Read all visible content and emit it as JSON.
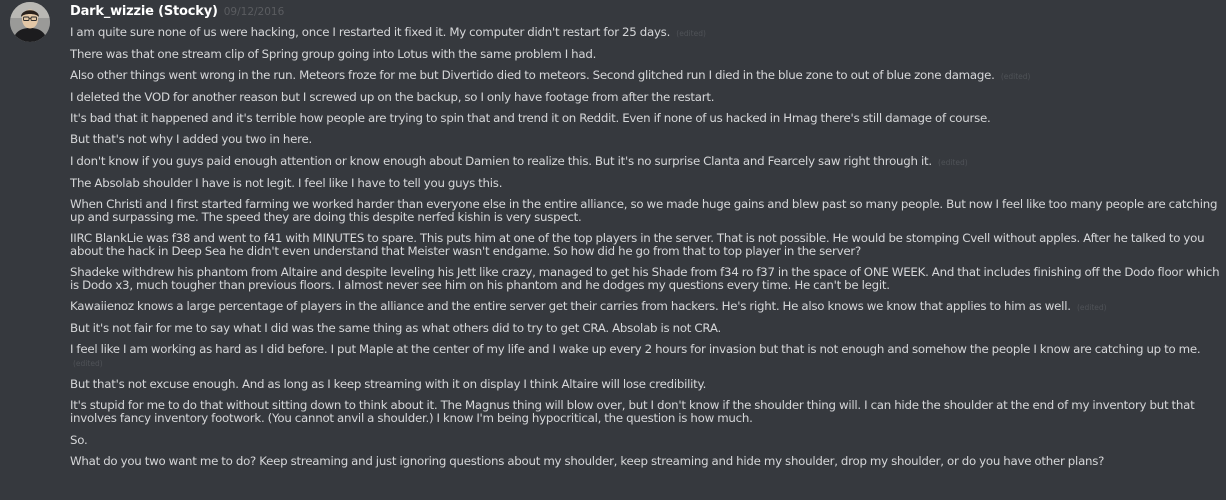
{
  "author": {
    "name": "Dark_wizzie (Stocky)",
    "timestamp": "09/12/2016"
  },
  "edited_label": "(edited)",
  "messages": [
    {
      "text": "I am quite sure none of us were hacking, once I restarted it fixed it. My  computer didn't restart for 25 days.",
      "edited": true
    },
    {
      "text": "There was that one stream clip of Spring group going into Lotus with the same problem I had.",
      "edited": false
    },
    {
      "text": "Also other things went wrong in the run. Meteors froze for me but Divertido died to meteors. Second glitched run I died in the blue zone to out of blue zone damage.",
      "edited": true
    },
    {
      "text": "I deleted the VOD for another reason but I screwed up on the backup, so I only have footage from after the restart.",
      "edited": false
    },
    {
      "text": "It's bad that it happened and it's terrible how people are trying to spin that and trend it on Reddit. Even if none of us hacked in Hmag there's still damage of course.",
      "edited": false
    },
    {
      "text": "But that's not why I added you two in here.",
      "edited": false
    },
    {
      "text": "I don't know if you guys paid enough attention or know enough about Damien to realize this. But it's no surprise Clanta and Fearcely saw right through it.",
      "edited": true
    },
    {
      "text": "The Absolab shoulder I have is not legit. I feel like I have to tell you guys this.",
      "edited": false
    },
    {
      "text": "When Christi and I first started farming we worked harder than everyone else in the entire alliance, so we made huge gains and blew past so many people. But now I feel like too many people are catching up and surpassing me. The speed they are doing this despite nerfed kishin is very suspect.",
      "edited": false
    },
    {
      "text": "IIRC BlankLie was f38 and went to f41 with MINUTES to spare. This puts him at one of the top players in the server. That is not possible. He would be stomping Cvell without apples. After he talked to you about the hack in Deep Sea he didn't even understand that Meister wasn't endgame. So how did he go from that to top player in the server?",
      "edited": false
    },
    {
      "text": "Shadeke withdrew his phantom from Altaire and despite leveling his Jett like crazy, managed to get his Shade from f34 ro f37 in the space of ONE WEEK. And that includes finishing off the Dodo floor which is Dodo x3, much tougher than previous floors. I almost never see him on his phantom and he dodges my questions every time. He can't be legit.",
      "edited": false
    },
    {
      "text": "Kawaiienoz knows a large percentage of players in the alliance and the entire server get their carries from hackers. He's right. He also knows we know that applies to him as well.",
      "edited": true
    },
    {
      "text": "But it's not fair for me to say what I did was the same thing as what others did to try to get CRA. Absolab is not CRA.",
      "edited": false
    },
    {
      "text": "I feel like I am working as hard as I did before. I put Maple at the center of my life and I wake up every 2 hours for invasion but that is not enough and somehow the people I know are catching up to me.",
      "edited": true
    },
    {
      "text": "But that's not excuse enough. And as long as I keep streaming with it on display I think Altaire will lose credibility.",
      "edited": false
    },
    {
      "text": "It's stupid for me to do that without sitting down to think about it. The Magnus thing will blow over, but I don't know if the shoulder thing will. I can hide the shoulder at the end of my inventory but that involves fancy inventory footwork. (You cannot anvil a shoulder.) I know I'm being hypocritical, the question is how much.",
      "edited": false
    },
    {
      "text": "So.",
      "edited": false
    },
    {
      "text": "What do you two want me to do? Keep streaming and just ignoring questions about my shoulder, keep streaming and hide my shoulder, drop my shoulder, or do you have other plans?",
      "edited": false
    }
  ]
}
